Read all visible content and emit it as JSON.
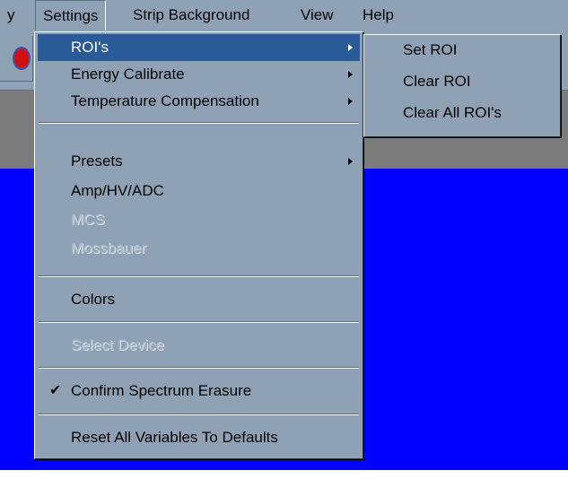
{
  "menubar": {
    "items": [
      "y",
      "Settings",
      "Strip Background",
      "View",
      "Help"
    ]
  },
  "settings_menu": {
    "items": [
      {
        "label": "ROI's",
        "submenu": true,
        "highlighted": true,
        "enabled": true
      },
      {
        "label": "Energy Calibrate",
        "submenu": true,
        "enabled": true
      },
      {
        "label": "Temperature Compensation",
        "submenu": true,
        "enabled": true
      },
      {
        "label": "Presets",
        "submenu": true,
        "enabled": true
      },
      {
        "label": "Amp/HV/ADC",
        "enabled": true
      },
      {
        "label": "MCS",
        "enabled": false
      },
      {
        "label": "Mossbauer",
        "enabled": false
      },
      {
        "label": "Colors",
        "enabled": true
      },
      {
        "label": "Select Device",
        "enabled": false
      },
      {
        "label": "Confirm Spectrum Erasure",
        "checked": true,
        "enabled": true
      },
      {
        "label": "Reset All Variables To Defaults",
        "enabled": true
      }
    ]
  },
  "roi_submenu": {
    "items": [
      "Set ROI",
      "Clear ROI",
      "Clear All ROI's"
    ]
  },
  "icons": {
    "check": "✔",
    "toolbar_button": "red-circle-icon"
  },
  "colors": {
    "menu_bg": "#8fa2b5",
    "highlight": "#2a5b98",
    "client_bg": "#0000fe",
    "band": "#7b7b7b"
  }
}
